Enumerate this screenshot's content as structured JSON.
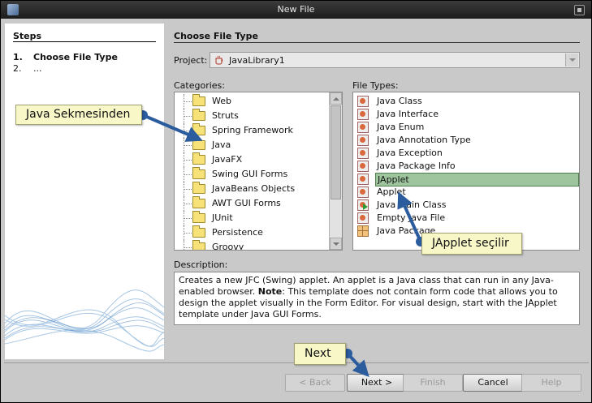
{
  "window": {
    "title": "New File"
  },
  "steps": {
    "heading": "Steps",
    "items": [
      {
        "num": "1.",
        "label": "Choose File Type"
      },
      {
        "num": "2.",
        "label": "..."
      }
    ]
  },
  "main": {
    "heading": "Choose File Type",
    "project_label": "Project:",
    "project_value": "JavaLibrary1",
    "categories_label": "Categories:",
    "file_types_label": "File Types:",
    "categories": [
      "Web",
      "Struts",
      "Spring Framework",
      "Java",
      "JavaFX",
      "Swing GUI Forms",
      "JavaBeans Objects",
      "AWT GUI Forms",
      "JUnit",
      "Persistence",
      "Groovy"
    ],
    "file_types": [
      {
        "label": "Java Class",
        "icon": "java-class-icon"
      },
      {
        "label": "Java Interface",
        "icon": "java-class-icon"
      },
      {
        "label": "Java Enum",
        "icon": "java-class-icon"
      },
      {
        "label": "Java Annotation Type",
        "icon": "java-class-icon"
      },
      {
        "label": "Java Exception",
        "icon": "java-class-icon"
      },
      {
        "label": "Java Package Info",
        "icon": "java-class-icon"
      },
      {
        "label": "JApplet",
        "icon": "java-class-icon",
        "selected": true
      },
      {
        "label": "Applet",
        "icon": "java-class-icon"
      },
      {
        "label": "Java Main Class",
        "icon": "java-main-class-icon"
      },
      {
        "label": "Empty Java File",
        "icon": "java-class-icon"
      },
      {
        "label": "Java Package",
        "icon": "package-icon"
      }
    ],
    "description_label": "Description:",
    "description": {
      "part1": "Creates a new JFC (Swing) applet. An applet is a Java class that can run in any Java-enabled browser. ",
      "note_label": "Note",
      "part2": ": This template does not contain form code that allows you to design the applet visually in the Form Editor. For visual design, start with the JApplet template under Java GUI Forms."
    }
  },
  "buttons": {
    "back": "< Back",
    "next": "Next >",
    "finish": "Finish",
    "cancel": "Cancel",
    "help": "Help"
  },
  "annotations": {
    "java_tab": "Java Sekmesinden",
    "japplet": "JApplet seçilir",
    "next": "Next"
  },
  "colors": {
    "selection": "#9fc59f",
    "callout_bg": "#f7f7c8",
    "arrow": "#2b5c9e"
  }
}
